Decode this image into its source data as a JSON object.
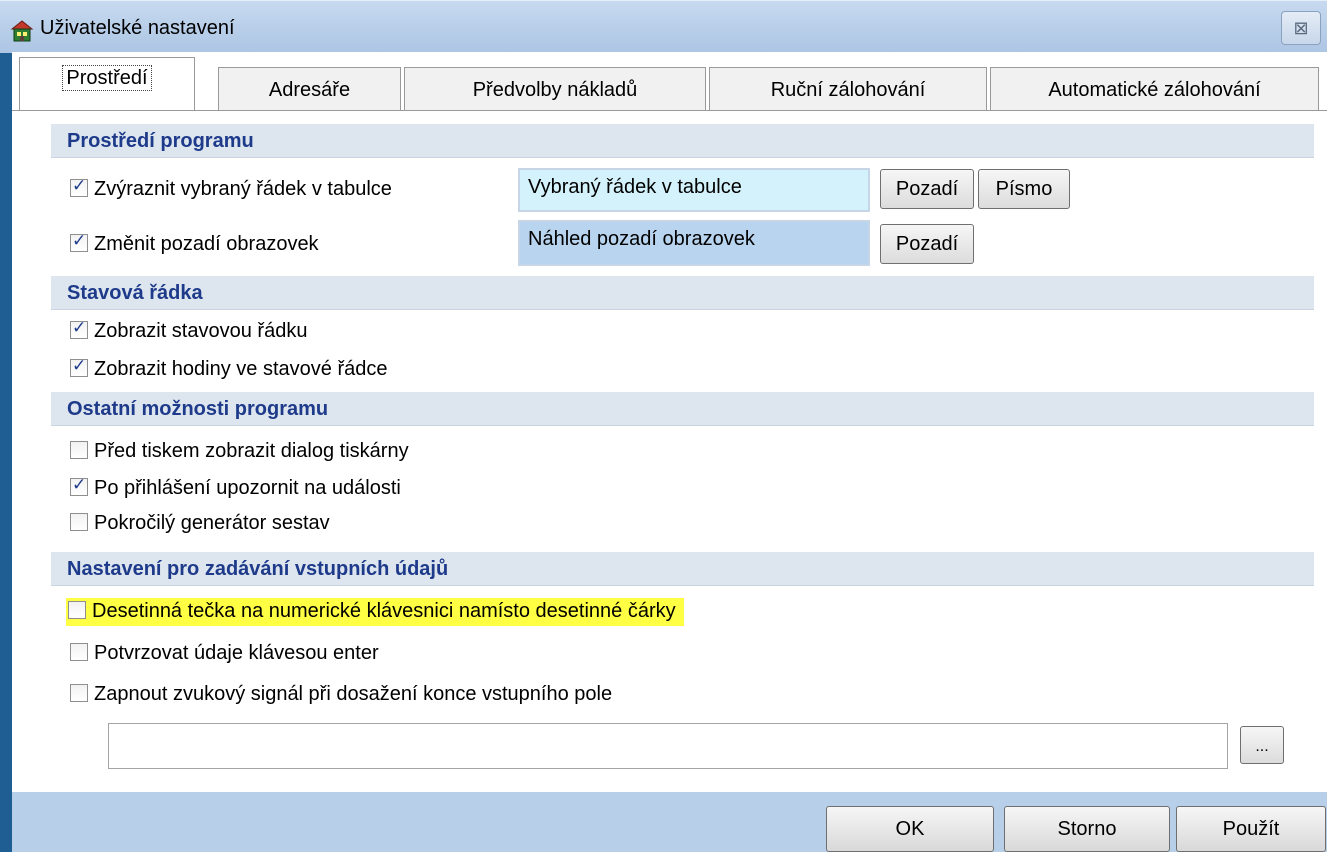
{
  "window": {
    "title": "Uživatelské nastavení",
    "close_glyph": "⊠",
    "icon": "app-house-icon"
  },
  "tabs": [
    {
      "label": "Prostředí",
      "active": true
    },
    {
      "label": "Adresáře",
      "active": false
    },
    {
      "label": "Předvolby nákladů",
      "active": false
    },
    {
      "label": "Ruční zálohování",
      "active": false
    },
    {
      "label": "Automatické zálohování",
      "active": false
    }
  ],
  "sections": {
    "environment": {
      "title": "Prostředí programu",
      "highlight_row": {
        "label": "Zvýraznit vybraný řádek v tabulce",
        "checked": true,
        "preview_text": "Vybraný řádek v tabulce",
        "preview_color": "#d3f2fb",
        "background_btn": "Pozadí",
        "font_btn": "Písmo"
      },
      "screen_bg_row": {
        "label": "Změnit pozadí obrazovek",
        "checked": true,
        "preview_text": "Náhled pozadí obrazovek",
        "preview_color": "#b9d4ef",
        "background_btn": "Pozadí"
      }
    },
    "status_bar": {
      "title": "Stavová řádka",
      "items": [
        {
          "label": "Zobrazit stavovou řádku",
          "checked": true
        },
        {
          "label": "Zobrazit hodiny ve stavové řádce",
          "checked": true
        }
      ]
    },
    "other": {
      "title": "Ostatní možnosti programu",
      "items": [
        {
          "label": "Před tiskem zobrazit dialog tiskárny",
          "checked": false
        },
        {
          "label": "Po přihlášení upozornit na události",
          "checked": true
        },
        {
          "label": "Pokročilý generátor sestav",
          "checked": false
        }
      ]
    },
    "input": {
      "title": "Nastavení pro zadávání vstupních údajů",
      "items": [
        {
          "label": "Desetinná tečka na numerické klávesnici namísto desetinné čárky",
          "checked": false,
          "highlighted": true
        },
        {
          "label": "Potvrzovat údaje  klávesou enter",
          "checked": false
        },
        {
          "label": "Zapnout zvukový signál při dosažení konce vstupního pole",
          "checked": false
        }
      ],
      "path_value": "",
      "browse_label": "..."
    }
  },
  "footer": {
    "ok": "OK",
    "cancel": "Storno",
    "apply": "Použít"
  },
  "colors": {
    "section_title": "#1e3a8a",
    "highlight": "#ffff44",
    "bottom_bar": "#b7cfe8"
  }
}
